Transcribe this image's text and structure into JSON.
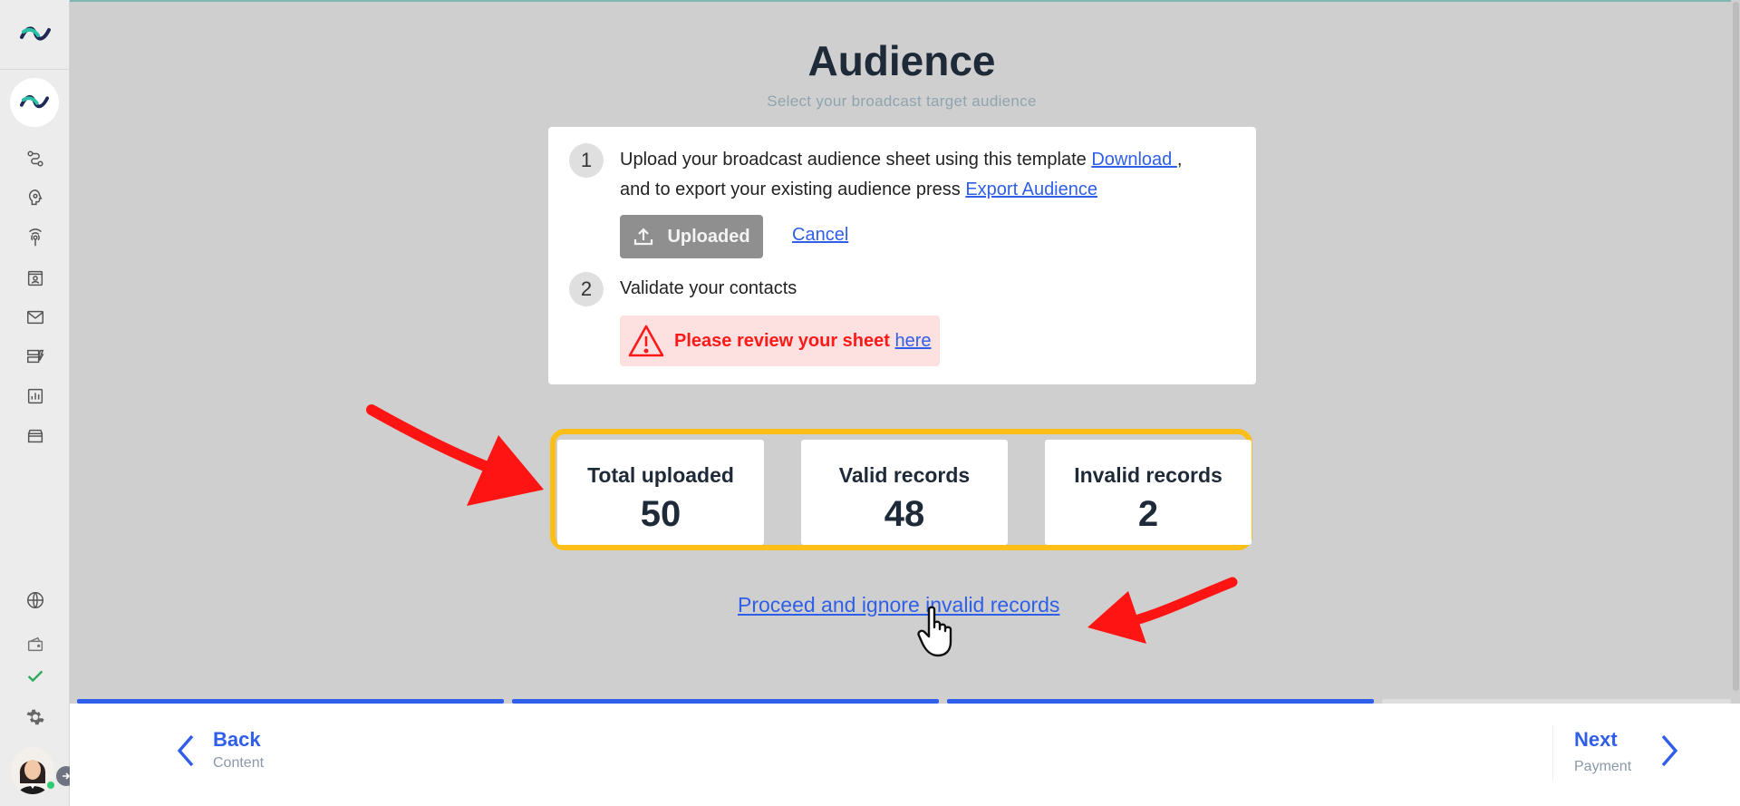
{
  "header": {
    "title": "Audience",
    "subtitle": "Select your broadcast target audience"
  },
  "steps": [
    {
      "number": "1",
      "text_before_download": "Upload your broadcast audience sheet using this template ",
      "download_link": "Download ",
      "text_after_download": ",",
      "text_line2": "and to export your existing audience press ",
      "export_link": "Export Audience",
      "uploaded_button": "Uploaded",
      "cancel_link": "Cancel"
    },
    {
      "number": "2",
      "text": "Validate your contacts",
      "warning_text": "Please review your sheet ",
      "warning_link": "here"
    }
  ],
  "stats": [
    {
      "label": "Total uploaded",
      "value": "50"
    },
    {
      "label": "Valid records",
      "value": "48"
    },
    {
      "label": "Invalid records",
      "value": "2"
    }
  ],
  "proceed_link": "Proceed and ignore invalid records",
  "progress": {
    "segments_total": 4,
    "segments_done": 3
  },
  "footer": {
    "back_label": "Back",
    "back_sub": "Content",
    "next_label": "Next",
    "next_sub": "Payment"
  },
  "colors": {
    "accent": "#2f5fe8",
    "highlight": "#fbbf18",
    "error": "#ff1a1a",
    "annotation_arrow": "#ff1414"
  },
  "sidebar": {
    "icons": [
      "flows-icon",
      "bot-icon",
      "broadcast-icon",
      "contacts-icon",
      "inbox-icon",
      "templates-icon",
      "analytics-icon",
      "store-icon",
      "globe-icon",
      "wallet-icon",
      "check-icon",
      "settings-icon"
    ]
  }
}
